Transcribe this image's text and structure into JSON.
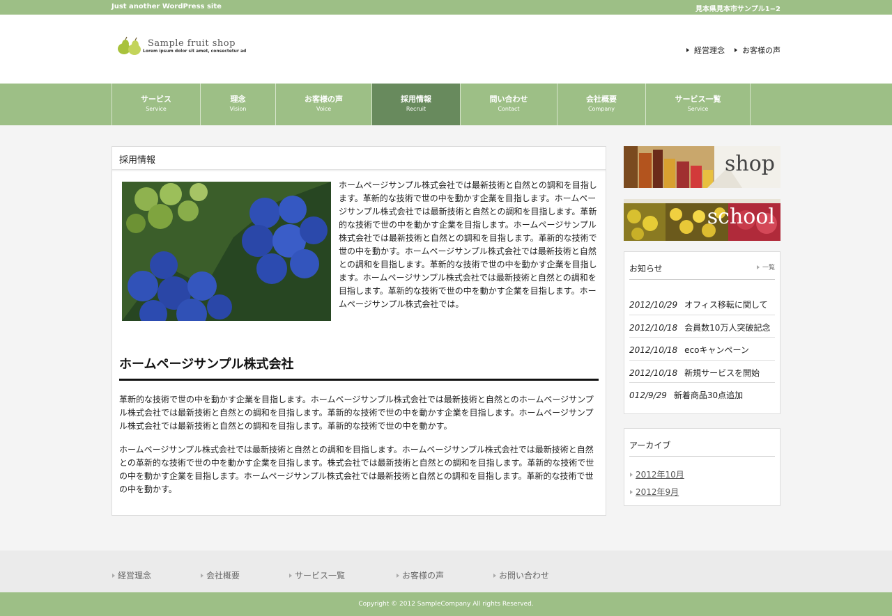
{
  "topbar": {
    "tagline": "Just another WordPress site",
    "address": "見本県見本市サンプル1−2"
  },
  "logo": {
    "name": "Sample fruit shop",
    "sub": "Lorem ipsum dolor sit amet, consectetur ad"
  },
  "header_links": [
    "経営理念",
    "お客様の声"
  ],
  "nav": [
    {
      "jp": "サービス",
      "en": "Service"
    },
    {
      "jp": "理念",
      "en": "Vision"
    },
    {
      "jp": "お客様の声",
      "en": "Voice"
    },
    {
      "jp": "採用情報",
      "en": "Recruit"
    },
    {
      "jp": "問い合わせ",
      "en": "Contact"
    },
    {
      "jp": "会社概要",
      "en": "Company"
    },
    {
      "jp": "サービス一覧",
      "en": "Service"
    }
  ],
  "main": {
    "title": "採用情報",
    "intro": "ホームページサンプル株式会社では最新技術と自然との調和を目指します。革新的な技術で世の中を動かす企業を目指します。ホームページサンプル株式会社では最新技術と自然との調和を目指します。革新的な技術で世の中を動かす企業を目指します。ホームページサンプル株式会社では最新技術と自然との調和を目指します。革新的な技術で世の中を動かす。ホームページサンプル株式会社では最新技術と自然との調和を目指します。革新的な技術で世の中を動かす企業を目指します。ホームページサンプル株式会社では最新技術と自然との調和を目指します。革新的な技術で世の中を動かす企業を目指します。ホームページサンプル株式会社では。",
    "company_heading": "ホームページサンプル株式会社",
    "para1": "革新的な技術で世の中を動かす企業を目指します。ホームページサンプル株式会社では最新技術と自然とのホームページサンプル株式会社では最新技術と自然との調和を目指します。革新的な技術で世の中を動かす企業を目指します。ホームページサンプル株式会社では最新技術と自然との調和を目指します。革新的な技術で世の中を動かす。",
    "para2": "ホームページサンプル株式会社では最新技術と自然との調和を目指します。ホームページサンプル株式会社では最新技術と自然との革新的な技術で世の中を動かす企業を目指します。株式会社では最新技術と自然との調和を目指します。革新的な技術で世の中を動かす企業を目指します。ホームページサンプル株式会社では最新技術と自然との調和を目指します。革新的な技術で世の中を動かす。"
  },
  "banners": {
    "shop": "shop",
    "school": "school"
  },
  "news": {
    "title": "お知らせ",
    "more": "一覧",
    "items": [
      {
        "date": "2012/10/29",
        "text": "オフィス移転に関して"
      },
      {
        "date": "2012/10/18",
        "text": "会員数10万人突破記念"
      },
      {
        "date": "2012/10/18",
        "text": "ecoキャンペーン"
      },
      {
        "date": "2012/10/18",
        "text": "新規サービスを開始"
      },
      {
        "date": "012/9/29",
        "text": "新着商品30点追加"
      }
    ]
  },
  "archive": {
    "title": "アーカイブ",
    "items": [
      "2012年10月",
      "2012年9月"
    ]
  },
  "footer_links": [
    "経営理念",
    "会社概要",
    "サービス一覧",
    "お客様の声",
    "お問い合わせ"
  ],
  "copyright": "Copyright © 2012 SampleCompany All rights Reserved.",
  "colors": {
    "accent_green": "#9dbf86",
    "active_nav": "#688a5d"
  }
}
